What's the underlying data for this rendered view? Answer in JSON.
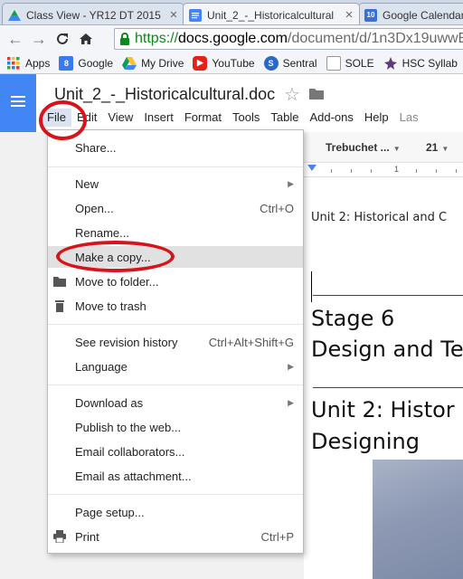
{
  "browser": {
    "tabs": [
      {
        "label": "Class View - YR12 DT 2015",
        "favicon_color": "#4caf50"
      },
      {
        "label": "Unit_2_-_Historicalcultural",
        "favicon_color": "#4285f4"
      },
      {
        "label": "Google Calendar",
        "favicon_color": "#3b6fd8",
        "favicon_text": "10"
      }
    ],
    "url": {
      "scheme": "https://",
      "host": "docs.google.com",
      "path": "/document/d/1n3Dx19uwwE"
    },
    "bookmarks": [
      {
        "label": "Apps",
        "icon": "apps-grid-icon"
      },
      {
        "label": "Google",
        "icon": "google-g-icon"
      },
      {
        "label": "My Drive",
        "icon": "drive-icon"
      },
      {
        "label": "YouTube",
        "icon": "youtube-icon"
      },
      {
        "label": "Sentral",
        "icon": "sentral-icon"
      },
      {
        "label": "SOLE",
        "icon": "page-icon"
      },
      {
        "label": "HSC Syllab",
        "icon": "crest-icon"
      }
    ]
  },
  "docs": {
    "title": "Unit_2_-_Historicalcultural.doc",
    "menus": [
      "File",
      "Edit",
      "View",
      "Insert",
      "Format",
      "Tools",
      "Table",
      "Add-ons",
      "Help",
      "Las"
    ],
    "font_name": "Trebuchet ...",
    "font_size": "21",
    "ruler_number": "1",
    "header_text": "Unit 2: Historical and C",
    "stage_line1": "Stage 6",
    "stage_line2": "Design and Te",
    "unit_line1": "Unit 2: Histor",
    "unit_line2": "Designing",
    "accent_color": "#4285f4"
  },
  "file_menu": {
    "share": "Share...",
    "new": "New",
    "open": "Open...",
    "open_shortcut": "Ctrl+O",
    "rename": "Rename...",
    "make_copy": "Make a copy...",
    "move_folder": "Move to folder...",
    "move_trash": "Move to trash",
    "revision": "See revision history",
    "revision_shortcut": "Ctrl+Alt+Shift+G",
    "language": "Language",
    "download": "Download as",
    "publish": "Publish to the web...",
    "email_collab": "Email collaborators...",
    "email_attach": "Email as attachment...",
    "page_setup": "Page setup...",
    "print": "Print",
    "print_shortcut": "Ctrl+P",
    "highlighted": "Make a copy..."
  },
  "annotation_color": "#d7141b"
}
